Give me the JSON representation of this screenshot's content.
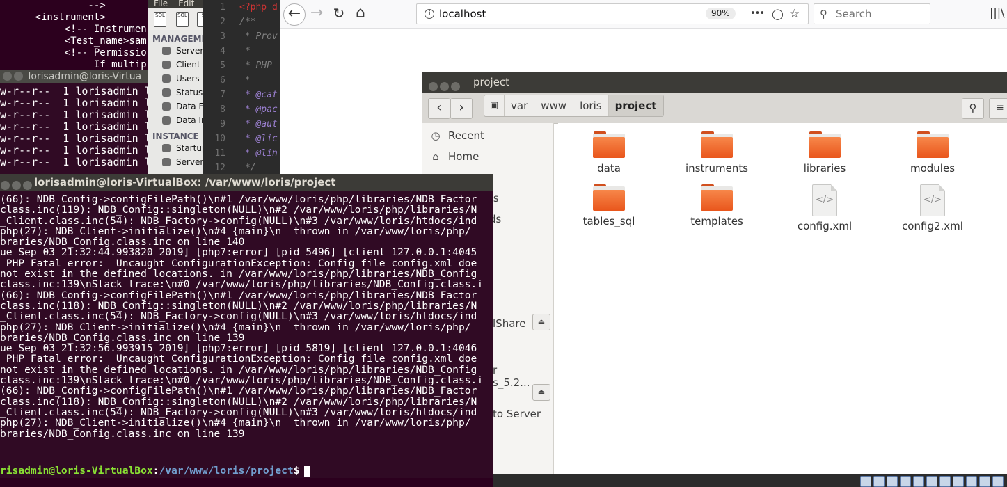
{
  "xml_terminal": {
    "lines": [
      "               -->",
      "      <instrument>",
      "           <!-- Instrumen",
      "           <Test_name>sam",
      "           <!-- Permissio",
      "                If multip"
    ]
  },
  "ls_terminal": {
    "title": "lorisadmin@loris-Virtua",
    "lines": [
      "w-r--r--  1 lorisadmin l",
      "w-r--r--  1 lorisadmin l",
      "w-r--r--  1 lorisadmin l",
      "w-r--r--  1 lorisadmin l",
      "w-r--r--  1 lorisadmin l",
      "w-r--r--  1 lorisadmin l",
      "w-r--r--  1 lorisadmin l"
    ]
  },
  "workbench": {
    "menu": [
      "File",
      "Edit"
    ],
    "management_header": "MANAGEME",
    "management_items": [
      "Server",
      "Client C",
      "Users a",
      "Status",
      "Data Ex",
      "Data In"
    ],
    "instance_header": "INSTANCE",
    "instance_items": [
      "Startup",
      "Server"
    ]
  },
  "editor": {
    "line_numbers": [
      "1",
      "2",
      "3",
      "4",
      "5",
      "6",
      "7",
      "8",
      "9",
      "10",
      "11",
      "12"
    ],
    "lines": [
      "<?php d",
      "/**",
      " * Prov",
      " *",
      " * PHP",
      " *",
      " * @cat",
      " * @pac",
      " * @aut",
      " * @lic",
      " * @lin",
      " */"
    ]
  },
  "browser": {
    "url": "localhost",
    "zoom": "90%",
    "search_placeholder": "Search",
    "more_label": "•••"
  },
  "files": {
    "window_title": "project",
    "path": [
      "var",
      "www",
      "loris",
      "project"
    ],
    "sidebar": [
      "Recent",
      "Home"
    ],
    "sidebar_partial": [
      "ts",
      "ds",
      "lShare",
      "r",
      "s_5.2...",
      "to Server"
    ],
    "items": [
      {
        "name": "data",
        "kind": "folder"
      },
      {
        "name": "instruments",
        "kind": "folder"
      },
      {
        "name": "libraries",
        "kind": "folder"
      },
      {
        "name": "modules",
        "kind": "folder"
      },
      {
        "name": "tables_sql",
        "kind": "folder"
      },
      {
        "name": "templates",
        "kind": "folder"
      },
      {
        "name": "config.xml",
        "kind": "xml"
      },
      {
        "name": "config2.xml",
        "kind": "xml"
      }
    ]
  },
  "terminal": {
    "title": "lorisadmin@loris-VirtualBox: /var/www/loris/project",
    "lines": [
      "(66): NDB_Config->configFilePath()\\n#1 /var/www/loris/php/libraries/NDB_Factor",
      "class.inc(119): NDB_Config::singleton(NULL)\\n#2 /var/www/loris/php/libraries/N",
      "_Client.class.inc(54): NDB_Factory->config(NULL)\\n#3 /var/www/loris/htdocs/ind",
      "php(27): NDB_Client->initialize()\\n#4 {main}\\n  thrown in /var/www/loris/php/",
      "braries/NDB_Config.class.inc on line 140",
      "ue Sep 03 21:32:44.993820 2019] [php7:error] [pid 5496] [client 127.0.0.1:4045",
      " PHP Fatal error:  Uncaught ConfigurationException: Config file config.xml doe",
      "not exist in the defined locations. in /var/www/loris/php/libraries/NDB_Config",
      "class.inc:139\\nStack trace:\\n#0 /var/www/loris/php/libraries/NDB_Config.class.i",
      "(66): NDB_Config->configFilePath()\\n#1 /var/www/loris/php/libraries/NDB_Factor",
      "class.inc(118): NDB_Config::singleton(NULL)\\n#2 /var/www/loris/php/libraries/N",
      "_Client.class.inc(54): NDB_Factory->config(NULL)\\n#3 /var/www/loris/htdocs/ind",
      "php(27): NDB_Client->initialize()\\n#4 {main}\\n  thrown in /var/www/loris/php/",
      "braries/NDB_Config.class.inc on line 139",
      "ue Sep 03 21:32:56.993915 2019] [php7:error] [pid 5819] [client 127.0.0.1:4046",
      " PHP Fatal error:  Uncaught ConfigurationException: Config file config.xml doe",
      "not exist in the defined locations. in /var/www/loris/php/libraries/NDB_Config",
      "class.inc:139\\nStack trace:\\n#0 /var/www/loris/php/libraries/NDB_Config.class.i",
      "(66): NDB_Config->configFilePath()\\n#1 /var/www/loris/php/libraries/NDB_Factor",
      "class.inc(118): NDB_Config::singleton(NULL)\\n#2 /var/www/loris/php/libraries/N",
      "_Client.class.inc(54): NDB_Factory->config(NULL)\\n#3 /var/www/loris/htdocs/ind",
      "php(27): NDB_Client->initialize()\\n#4 {main}\\n  thrown in /var/www/loris/php/",
      "braries/NDB_Config.class.inc on line 139"
    ],
    "prompt_user": "risadmin@loris-VirtualBox",
    "prompt_sep": ":",
    "prompt_path": "/var/www/loris/project",
    "prompt_symbol": "$"
  }
}
